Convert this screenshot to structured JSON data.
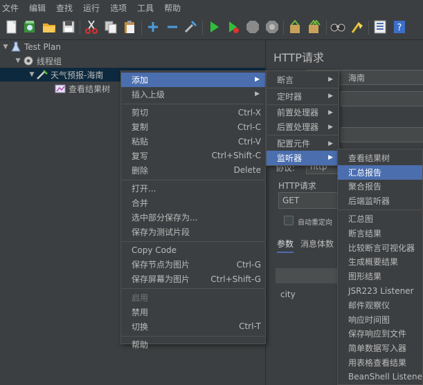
{
  "menubar": [
    "文件",
    "编辑",
    "查找",
    "运行",
    "选项",
    "工具",
    "帮助"
  ],
  "toolbar_icons": [
    "new-icon",
    "templates-icon",
    "open-icon",
    "save-icon",
    "cut-icon",
    "copy-icon",
    "paste-icon",
    "expand-icon",
    "collapse-icon",
    "toggle-icon",
    "start-icon",
    "start-no-pause-icon",
    "stop-icon",
    "shutdown-icon",
    "clear-icon",
    "clear-all-icon",
    "search-icon",
    "reset-search-icon",
    "function-helper-icon",
    "help-icon"
  ],
  "tree": {
    "test_plan": "Test Plan",
    "thread_group": "线程组",
    "http_sampler": "天气预报-海南",
    "listener": "查看结果树"
  },
  "right_pane": {
    "title": "HTTP请求",
    "name_value": "海南",
    "protocol_label": "协议:",
    "protocol_value": "http",
    "http_section": "HTTP请求",
    "method": "GET",
    "auto_redirect": "自动重定向",
    "tab_params": "参数",
    "tab_body": "消息体数",
    "param_row": "city"
  },
  "context_menu": {
    "items": [
      {
        "label": "添加",
        "submenu": true,
        "highlighted": true
      },
      {
        "label": "插入上级",
        "submenu": true
      },
      {
        "sep": true
      },
      {
        "label": "剪切",
        "shortcut": "Ctrl-X"
      },
      {
        "label": "复制",
        "shortcut": "Ctrl-C"
      },
      {
        "label": "粘贴",
        "shortcut": "Ctrl-V"
      },
      {
        "label": "复写",
        "shortcut": "Ctrl+Shift-C"
      },
      {
        "label": "删除",
        "shortcut": "Delete"
      },
      {
        "sep": true
      },
      {
        "label": "打开..."
      },
      {
        "label": "合并"
      },
      {
        "label": "选中部分保存为..."
      },
      {
        "label": "保存为测试片段"
      },
      {
        "sep": true
      },
      {
        "label": "Copy Code"
      },
      {
        "label": "保存节点为图片",
        "shortcut": "Ctrl-G"
      },
      {
        "label": "保存屏幕为图片",
        "shortcut": "Ctrl+Shift-G"
      },
      {
        "sep": true
      },
      {
        "label": "启用",
        "disabled": true
      },
      {
        "label": "禁用"
      },
      {
        "label": "切换",
        "shortcut": "Ctrl-T"
      },
      {
        "sep": true
      },
      {
        "label": "帮助"
      }
    ]
  },
  "add_submenu": {
    "items": [
      {
        "label": "断言",
        "submenu": true
      },
      {
        "sep": true
      },
      {
        "label": "定时器",
        "submenu": true
      },
      {
        "sep": true
      },
      {
        "label": "前置处理器",
        "submenu": true
      },
      {
        "label": "后置处理器",
        "submenu": true
      },
      {
        "sep": true
      },
      {
        "label": "配置元件",
        "submenu": true
      },
      {
        "label": "监听器",
        "submenu": true,
        "highlighted": true
      }
    ]
  },
  "listener_submenu": {
    "items": [
      {
        "label": "查看结果树"
      },
      {
        "label": "汇总报告",
        "highlighted": true
      },
      {
        "label": "聚合报告"
      },
      {
        "label": "后端监听器"
      },
      {
        "sep": true
      },
      {
        "label": "汇总图"
      },
      {
        "label": "断言结果"
      },
      {
        "label": "比较断言可视化器"
      },
      {
        "label": "生成概要结果"
      },
      {
        "label": "图形结果"
      },
      {
        "label": "JSR223 Listener"
      },
      {
        "label": "邮件观察仪"
      },
      {
        "label": "响应时间图"
      },
      {
        "label": "保存响应到文件"
      },
      {
        "label": "简单数据写入器"
      },
      {
        "label": "用表格查看结果"
      },
      {
        "label": "BeanShell Listener"
      }
    ]
  }
}
